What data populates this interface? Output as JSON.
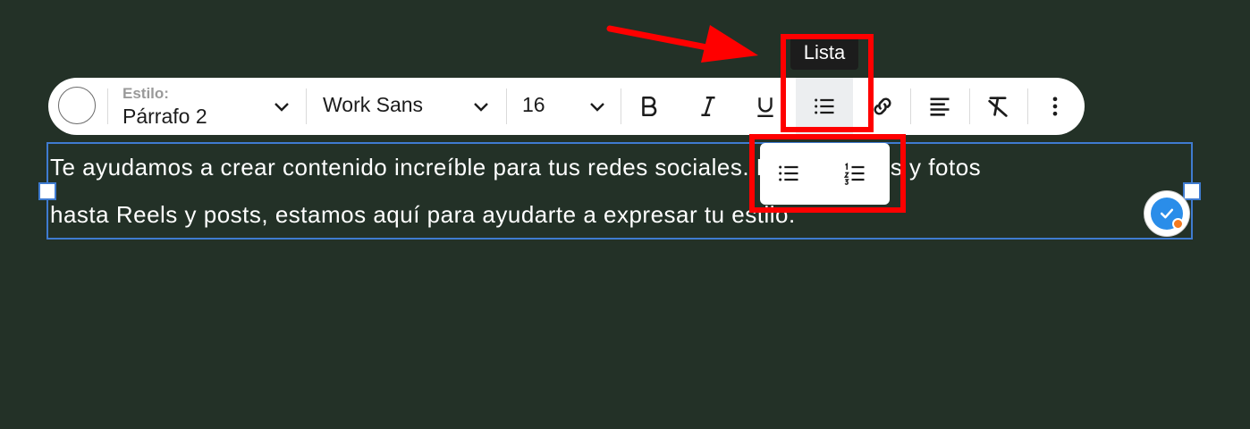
{
  "toolbar": {
    "style_label": "Estilo:",
    "style_value": "Párrafo 2",
    "font_family": "Work Sans",
    "font_size": "16",
    "icons": [
      "color-swatch-icon",
      "chevron-down-icon",
      "bold-icon",
      "italic-icon",
      "underline-icon",
      "bullet-list-icon",
      "link-icon",
      "align-left-icon",
      "clear-format-icon",
      "more-vertical-icon"
    ]
  },
  "tooltip": {
    "text": "Lista"
  },
  "list_menu": {
    "options": [
      "bullet-list-icon",
      "numbered-list-icon"
    ]
  },
  "editor": {
    "line1": "Te ayudamos a crear contenido increíble para tus redes sociales. Desde videos y fotos",
    "line2": "hasta Reels y posts, estamos aquí para ayudarte a expresar tu estilo."
  },
  "colors": {
    "background": "#233127",
    "highlight": "#ff0000",
    "selection": "#3f7bd0",
    "badge": "#2a8de9",
    "badge_dot": "#f47a20"
  }
}
